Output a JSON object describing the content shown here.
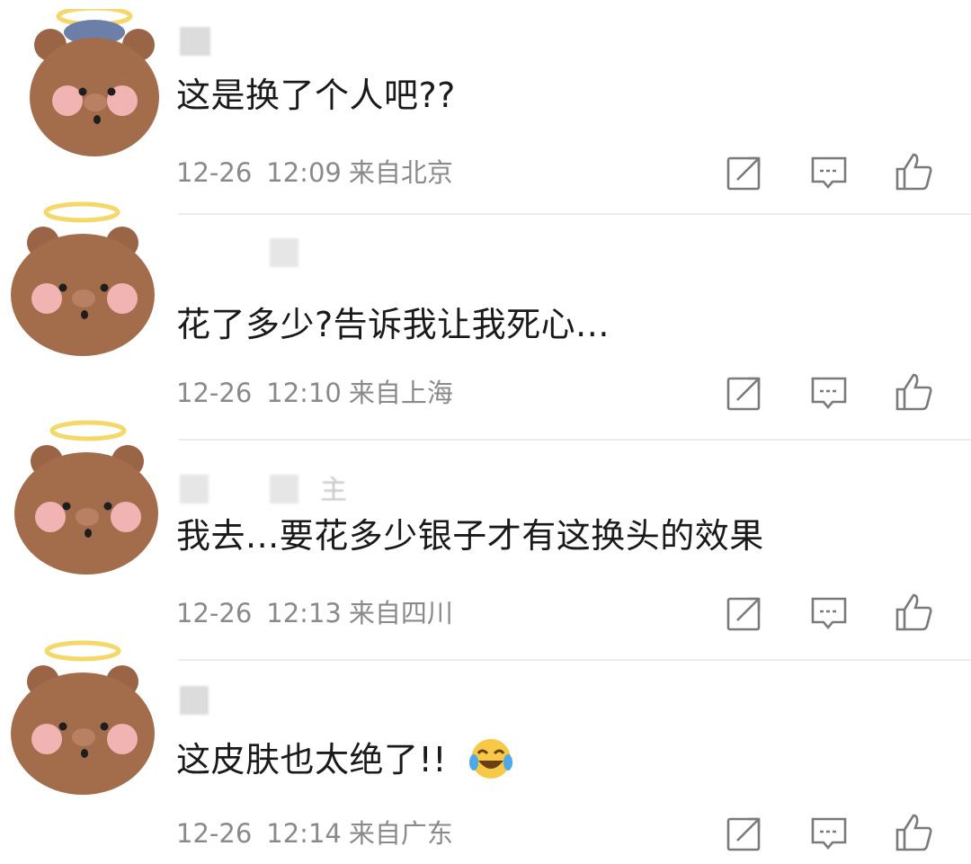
{
  "comments": [
    {
      "text": "这是换了个人吧??",
      "date": "12-26",
      "time": "12:09",
      "location": "来自北京",
      "has_emoji": false,
      "halo": false
    },
    {
      "text": "花了多少?告诉我让我死心...",
      "date": "12-26",
      "time": "12:10",
      "location": "来自上海",
      "has_emoji": false,
      "halo": true
    },
    {
      "text": "我去...要花多少银子才有这换头的效果",
      "date": "12-26",
      "time": "12:13",
      "location": "来自四川",
      "username_fragment": "主",
      "has_emoji": false,
      "halo": true
    },
    {
      "text": "这皮肤也太绝了!!",
      "date": "12-26",
      "time": "12:14",
      "location": "来自广东",
      "has_emoji": true,
      "emoji": "laughing-crying-emoji",
      "halo": true
    }
  ],
  "icons": {
    "share": "share-icon",
    "reply": "reply-icon",
    "like": "thumbs-up-icon"
  },
  "colors": {
    "text": "#1a1a1a",
    "meta": "#8a8a8a",
    "icon": "#7a7a7a",
    "bear": "#a06a4a",
    "cheek": "#f2b3b3",
    "halo": "#f5d86a",
    "divider": "#ececec"
  }
}
